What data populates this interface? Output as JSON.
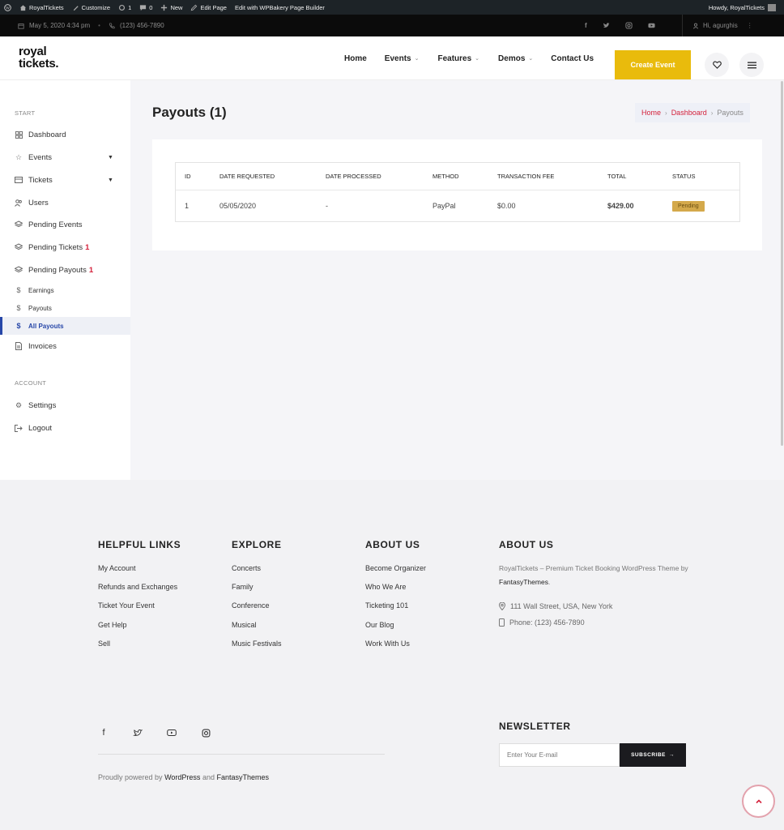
{
  "admin_bar": {
    "site_name": "RoyalTickets",
    "customize": "Customize",
    "updates_count": "1",
    "comments_count": "0",
    "new": "New",
    "edit_page": "Edit Page",
    "edit_with": "Edit with WPBakery Page Builder",
    "howdy": "Howdy, RoyalTickets"
  },
  "top_bar": {
    "date": "May 5, 2020 4:34 pm",
    "phone": "(123) 456-7890",
    "user_greeting": "Hi, agurghis"
  },
  "header": {
    "logo_line1": "royal",
    "logo_line2": "tickets.",
    "nav": [
      {
        "label": "Home"
      },
      {
        "label": "Events"
      },
      {
        "label": "Features"
      },
      {
        "label": "Demos"
      },
      {
        "label": "Contact Us"
      }
    ],
    "create_event": "Create Event"
  },
  "sidebar": {
    "start_heading": "START",
    "items": [
      {
        "label": "Dashboard"
      },
      {
        "label": "Events"
      },
      {
        "label": "Tickets"
      },
      {
        "label": "Users"
      },
      {
        "label": "Pending Events"
      },
      {
        "label": "Pending Tickets",
        "badge": "1"
      },
      {
        "label": "Pending Payouts",
        "badge": "1"
      },
      {
        "label": "Earnings"
      },
      {
        "label": "Payouts"
      },
      {
        "label": "All Payouts"
      },
      {
        "label": "Invoices"
      }
    ],
    "account_heading": "ACCOUNT",
    "account_items": [
      {
        "label": "Settings"
      },
      {
        "label": "Logout"
      }
    ]
  },
  "main": {
    "title": "Payouts (1)",
    "breadcrumb": {
      "home": "Home",
      "dashboard": "Dashboard",
      "current": "Payouts"
    },
    "table": {
      "headers": [
        "ID",
        "DATE REQUESTED",
        "DATE PROCESSED",
        "METHOD",
        "TRANSACTION FEE",
        "TOTAL",
        "STATUS"
      ],
      "rows": [
        {
          "id": "1",
          "date_requested": "05/05/2020",
          "date_processed": "-",
          "method": "PayPal",
          "fee": "$0.00",
          "total": "$429.00",
          "status": "Pending"
        }
      ]
    }
  },
  "footer": {
    "helpful": {
      "title": "HELPFUL LINKS",
      "links": [
        "My Account",
        "Refunds and Exchanges",
        "Ticket Your Event",
        "Get Help",
        "Sell"
      ]
    },
    "explore": {
      "title": "EXPLORE",
      "links": [
        "Concerts",
        "Family",
        "Conference",
        "Musical",
        "Music Festivals"
      ]
    },
    "about1": {
      "title": "ABOUT US",
      "links": [
        "Become Organizer",
        "Who We Are",
        "Ticketing 101",
        "Our Blog",
        "Work With Us"
      ]
    },
    "about2": {
      "title": "ABOUT US",
      "text": "RoyalTickets – Premium Ticket Booking WordPress Theme by",
      "brand": "FantasyThemes",
      "address": "111 Wall Street, USA, New York",
      "phone": "Phone: (123) 456-7890"
    },
    "powered": {
      "prefix": "Proudly powered by",
      "wp": "WordPress",
      "and": "and",
      "ft": "FantasyThemes"
    },
    "newsletter": {
      "title": "NEWSLETTER",
      "placeholder": "Enter Your E-mail",
      "button": "SUBSCRIBE"
    }
  },
  "colors": {
    "accent": "#d4223c",
    "create_button": "#e9bb0c",
    "active_nav": "#2747a8",
    "status_pending": "#d4a94b"
  }
}
